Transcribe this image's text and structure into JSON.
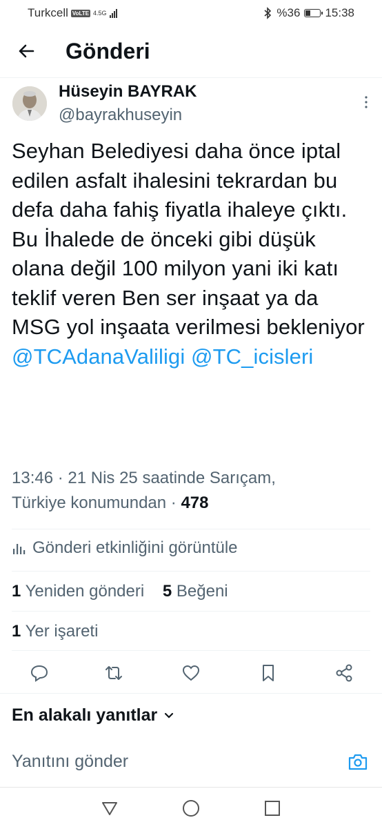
{
  "status_bar": {
    "carrier": "Turkcell",
    "volte": "VoLTE",
    "network": "4.5G",
    "battery": "%36",
    "battery_level": 0.36,
    "time": "15:38"
  },
  "header": {
    "title": "Gönderi"
  },
  "author": {
    "name": "Hüseyin BAYRAK",
    "handle": "@bayrakhuseyin"
  },
  "tweet": {
    "text": "Seyhan Belediyesi daha önce iptal edilen asfalt ihalesini tekrardan bu defa daha fahiş fiyatla ihaleye çıktı. Bu İhalede de önceki gibi düşük olana değil 100 milyon yani iki katı teklif veren Ben ser inşaat ya da MSG yol inşaata verilmesi bekleniyor",
    "mention_1": "@TCAdanaValiligi",
    "mention_2": "@TC_icisleri",
    "meta_line_1": "13:46 · 21 Nis 25 saatinde Sarıçam,",
    "meta_line_2": "Türkiye konumundan · ",
    "views": "478"
  },
  "activity_label": "Gönderi etkinliğini görüntüle",
  "stats": {
    "reposts_count": "1",
    "reposts_label": "Yeniden gönderi",
    "likes_count": "5",
    "likes_label": "Beğeni",
    "bookmarks_count": "1",
    "bookmarks_label": "Yer işareti"
  },
  "actions": {
    "icons": [
      "reply-icon",
      "repost-icon",
      "like-icon",
      "bookmark-icon",
      "share-icon"
    ]
  },
  "replies": {
    "sort_label": "En alakalı yanıtlar",
    "placeholder": "Yanıtını gönder"
  },
  "colors": {
    "accent": "#1d9bf0",
    "text": "#0f1419",
    "secondary": "#536471"
  }
}
